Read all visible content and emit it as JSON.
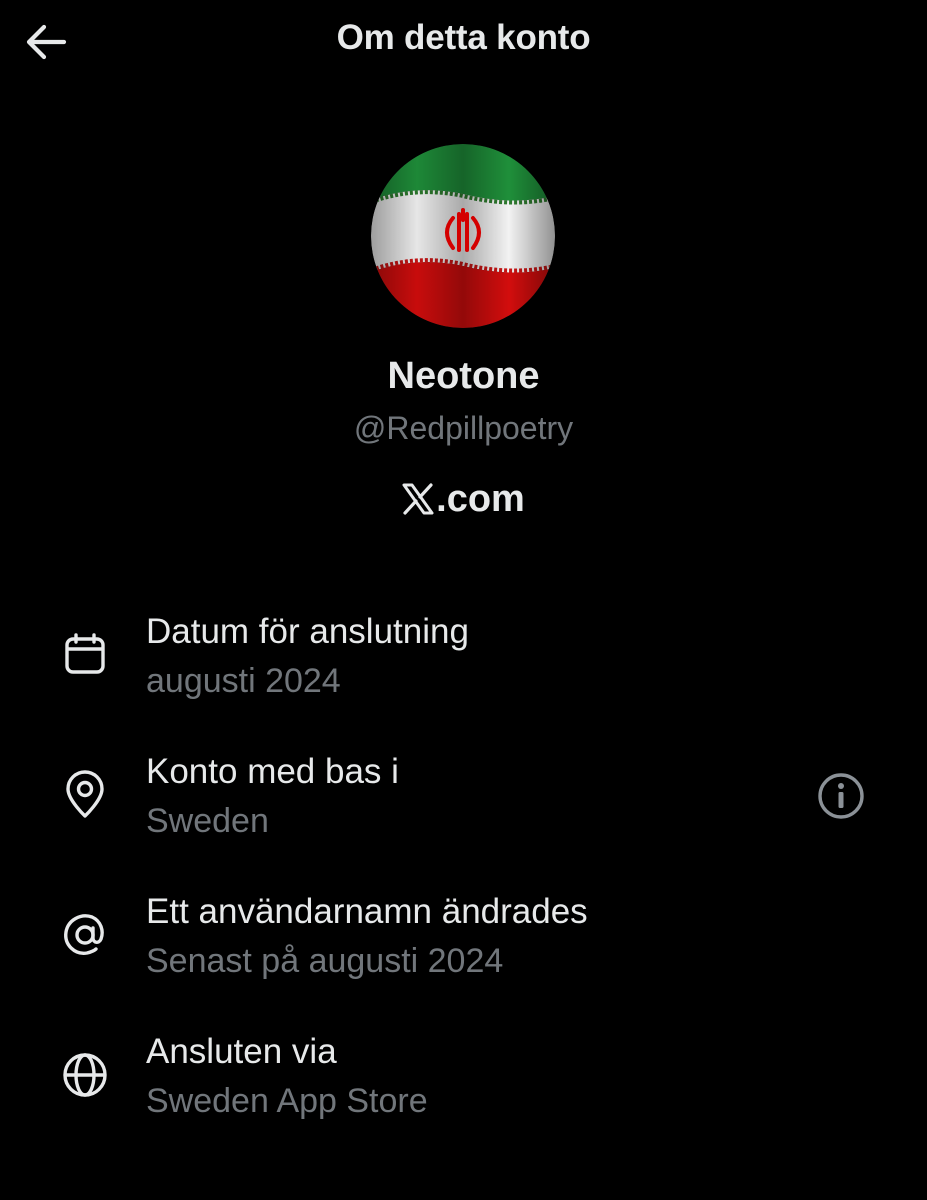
{
  "header": {
    "title": "Om detta konto",
    "back_icon": "arrow-left-icon"
  },
  "profile": {
    "avatar_description": "iran-flag-avatar",
    "display_name": "Neotone",
    "handle": "@Redpillpoetry",
    "platform": ".com",
    "platform_logo": "x-logo-icon"
  },
  "details": [
    {
      "icon": "calendar-icon",
      "title": "Datum för anslutning",
      "value": "augusti 2024"
    },
    {
      "icon": "location-pin-icon",
      "title": "Konto med bas i",
      "value": "Sweden",
      "action_icon": "info-icon"
    },
    {
      "icon": "at-sign-icon",
      "title": "Ett användarnamn ändrades",
      "value": "Senast på augusti 2024"
    },
    {
      "icon": "globe-icon",
      "title": "Ansluten via",
      "value": "Sweden App Store"
    }
  ],
  "colors": {
    "background": "#000000",
    "primary_text": "#e7e9ea",
    "secondary_text": "#71767b",
    "flag_green": "#239f40",
    "flag_white": "#ffffff",
    "flag_red": "#da0000"
  }
}
